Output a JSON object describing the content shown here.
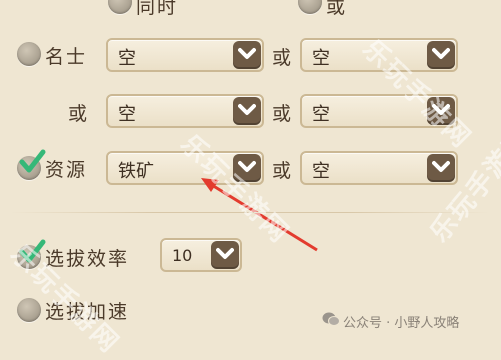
{
  "top_row": {
    "label1": "同时",
    "label2": "或"
  },
  "rows": [
    {
      "name": "名士",
      "left": "空",
      "or": "或",
      "right": "空"
    },
    {
      "name": "或",
      "left": "空",
      "or": "或",
      "right": "空"
    },
    {
      "name": "资源",
      "left": "铁矿",
      "or": "或",
      "right": "空"
    }
  ],
  "efficiency": {
    "label": "选拔效率",
    "value": "10"
  },
  "speed": {
    "label": "选拔加速"
  },
  "footer": {
    "text": "公众号 · 小野人攻略"
  },
  "watermark": {
    "text": "乐玩手游网"
  },
  "colors": {
    "background": "#efe6d2",
    "dropdown_button": "#6e5a45",
    "check": "#35b878",
    "arrow": "#e33b2e"
  }
}
